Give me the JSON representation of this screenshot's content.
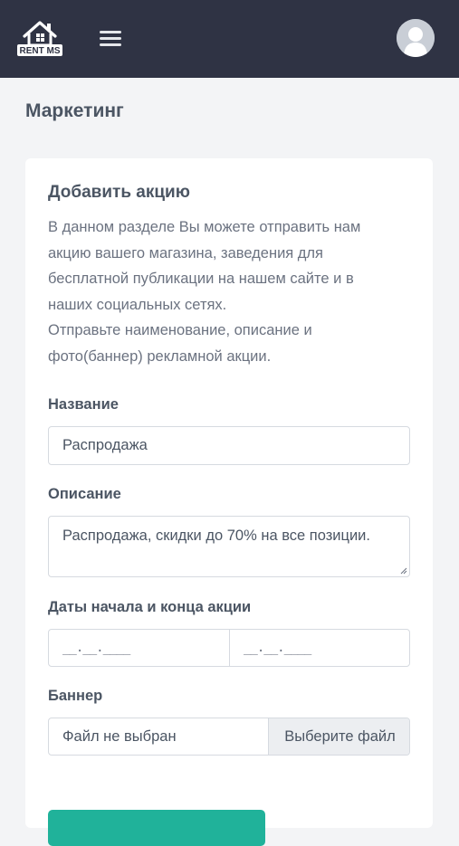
{
  "app": {
    "logo_text": "RENT MS"
  },
  "page": {
    "title": "Маркетинг"
  },
  "card": {
    "title": "Добавить акцию",
    "description_line1": "В данном разделе Вы можете отправить нам",
    "description_line2": "акцию вашего магазина, заведения для",
    "description_line3": "бесплатной публикации на нашем сайте и в",
    "description_line4": "наших социальных сетях.",
    "description_line5": "Отправьте наименование, описание и",
    "description_line6": "фото(баннер) рекламной акции."
  },
  "form": {
    "name_label": "Название",
    "name_value": "Распродажа",
    "description_label": "Описание",
    "description_value": "Распродажа, скидки до 70% на все позиции.",
    "dates_label": "Даты начала и конца акции",
    "date_start_mask": "__.__.____",
    "date_end_mask": "__.__.____",
    "banner_label": "Баннер",
    "file_status": "Файл не выбран",
    "file_button": "Выберите файл"
  },
  "colors": {
    "topbar": "#2f3344",
    "accent": "#20b29a",
    "background": "#f3f4f6"
  },
  "icons": {
    "logo": "house-logo-icon",
    "menu": "hamburger-menu-icon",
    "avatar": "user-avatar-icon"
  }
}
